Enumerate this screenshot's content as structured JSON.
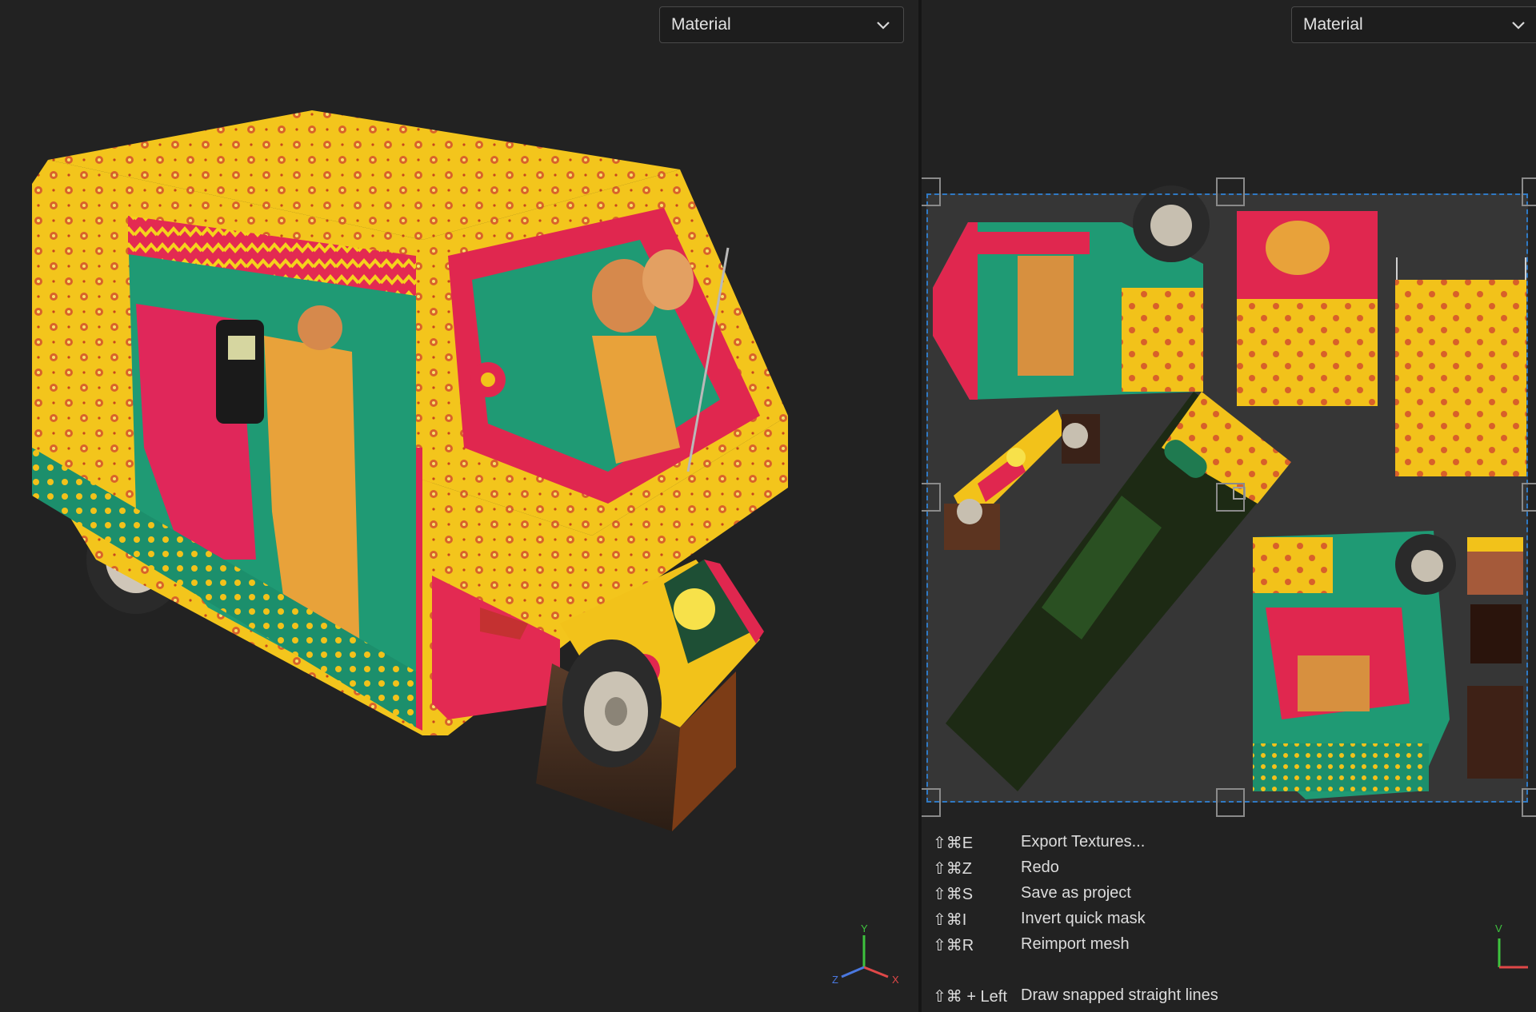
{
  "viewport_3d": {
    "channel_dropdown": {
      "value": "Material"
    },
    "axis_gizmo": {
      "y_label": "Y",
      "x_label": "X",
      "z_label": "Z"
    }
  },
  "viewport_uv": {
    "channel_dropdown": {
      "value": "Material"
    },
    "axis_gizmo": {
      "v_label": "V"
    },
    "shortcuts": [
      {
        "keys": "⇧⌘E",
        "label": "Export Textures..."
      },
      {
        "keys": "⇧⌘Z",
        "label": "Redo"
      },
      {
        "keys": "⇧⌘S",
        "label": "Save as project"
      },
      {
        "keys": "⇧⌘I",
        "label": "Invert quick mask"
      },
      {
        "keys": "⇧⌘R",
        "label": "Reimport mesh"
      },
      {
        "keys": "⇧⌘ + Left",
        "label": "Draw snapped straight lines"
      }
    ]
  },
  "colors": {
    "background": "#222222",
    "selection_dashes": "#2f79c4",
    "texture_yellow": "#f2c21a",
    "texture_red": "#e0274f",
    "texture_green": "#1f9a74"
  }
}
